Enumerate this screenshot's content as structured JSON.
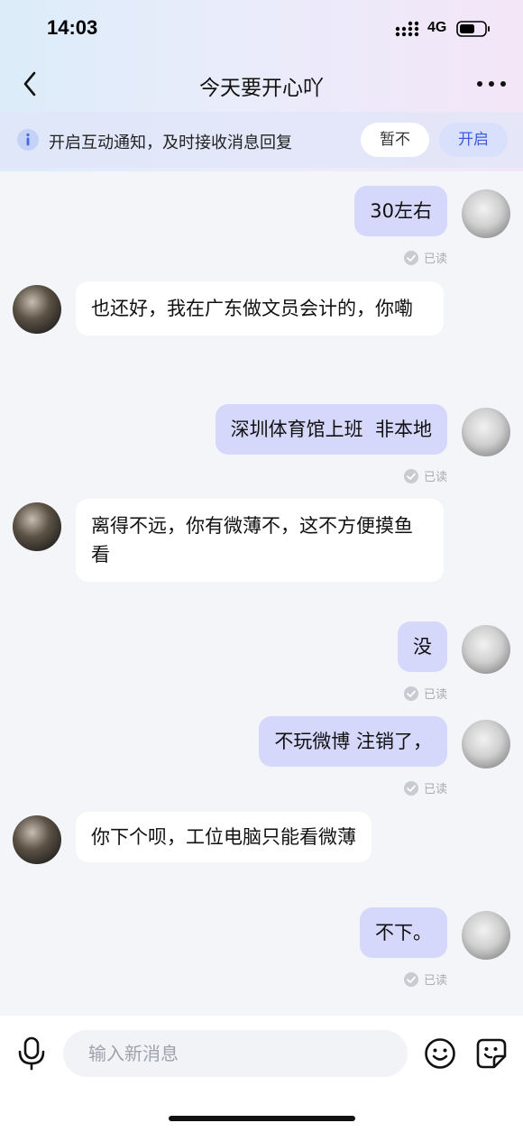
{
  "status_bar": {
    "time": "14:03",
    "network": "4G"
  },
  "header": {
    "title": "今天要开心吖"
  },
  "notify_banner": {
    "text": "开启互动通知，及时接收消息回复",
    "later_label": "暂不",
    "enable_label": "开启"
  },
  "messages": [
    {
      "from": "self",
      "text": "30左右",
      "status": "已读"
    },
    {
      "from": "other",
      "text": "也还好，我在广东做文员会计的，你嘞"
    },
    {
      "from": "self",
      "text": "深圳体育馆上班  非本地",
      "status": "已读"
    },
    {
      "from": "other",
      "text": "离得不远，你有微薄不，这不方便摸鱼看"
    },
    {
      "from": "self",
      "text": "没",
      "status": "已读"
    },
    {
      "from": "self",
      "text": "不玩微博 注销了，",
      "status": "已读"
    },
    {
      "from": "other",
      "text": "你下个呗，工位电脑只能看微薄"
    },
    {
      "from": "self",
      "text": "不下。",
      "status": "已读"
    }
  ],
  "input": {
    "placeholder": "输入新消息",
    "value": ""
  },
  "icons": {
    "back": "chevron-left-icon",
    "more": "more-dots-icon",
    "info": "info-icon",
    "mic": "microphone-icon",
    "emoji": "emoji-icon",
    "sticker": "sticker-icon",
    "read": "check-circle-icon"
  },
  "colors": {
    "self_bubble": "#d5d7fb",
    "other_bubble": "#ffffff",
    "accent": "#3d5be0",
    "background": "#f4f5f8"
  }
}
